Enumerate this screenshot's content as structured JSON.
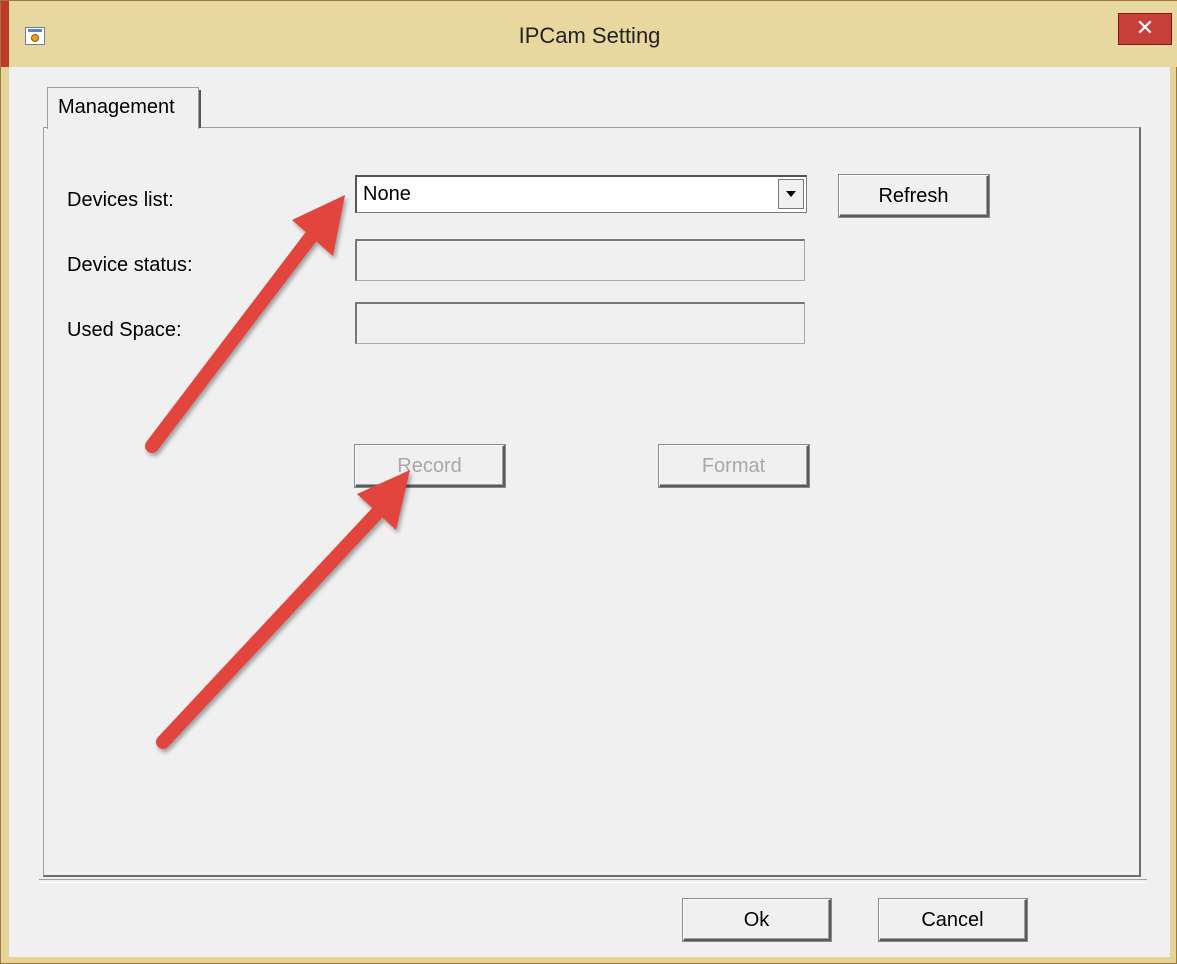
{
  "window": {
    "title": "IPCam Setting",
    "close_glyph": "✕"
  },
  "tabs": [
    {
      "label": "Management"
    }
  ],
  "form": {
    "devices_list_label": "Devices list:",
    "devices_list_value": "None",
    "device_status_label": "Device status:",
    "device_status_value": "",
    "used_space_label": "Used Space:",
    "used_space_value": ""
  },
  "buttons": {
    "refresh": "Refresh",
    "record": "Record",
    "format": "Format",
    "ok": "Ok",
    "cancel": "Cancel"
  },
  "icons": {
    "app": "app-icon",
    "close": "close-icon",
    "dropdown": "chevron-down-icon"
  },
  "colors": {
    "title_bar": "#e9d7a0",
    "close_button": "#c7413a",
    "annotation_arrow": "#e2453c",
    "disabled_text": "#a8a8a8"
  }
}
